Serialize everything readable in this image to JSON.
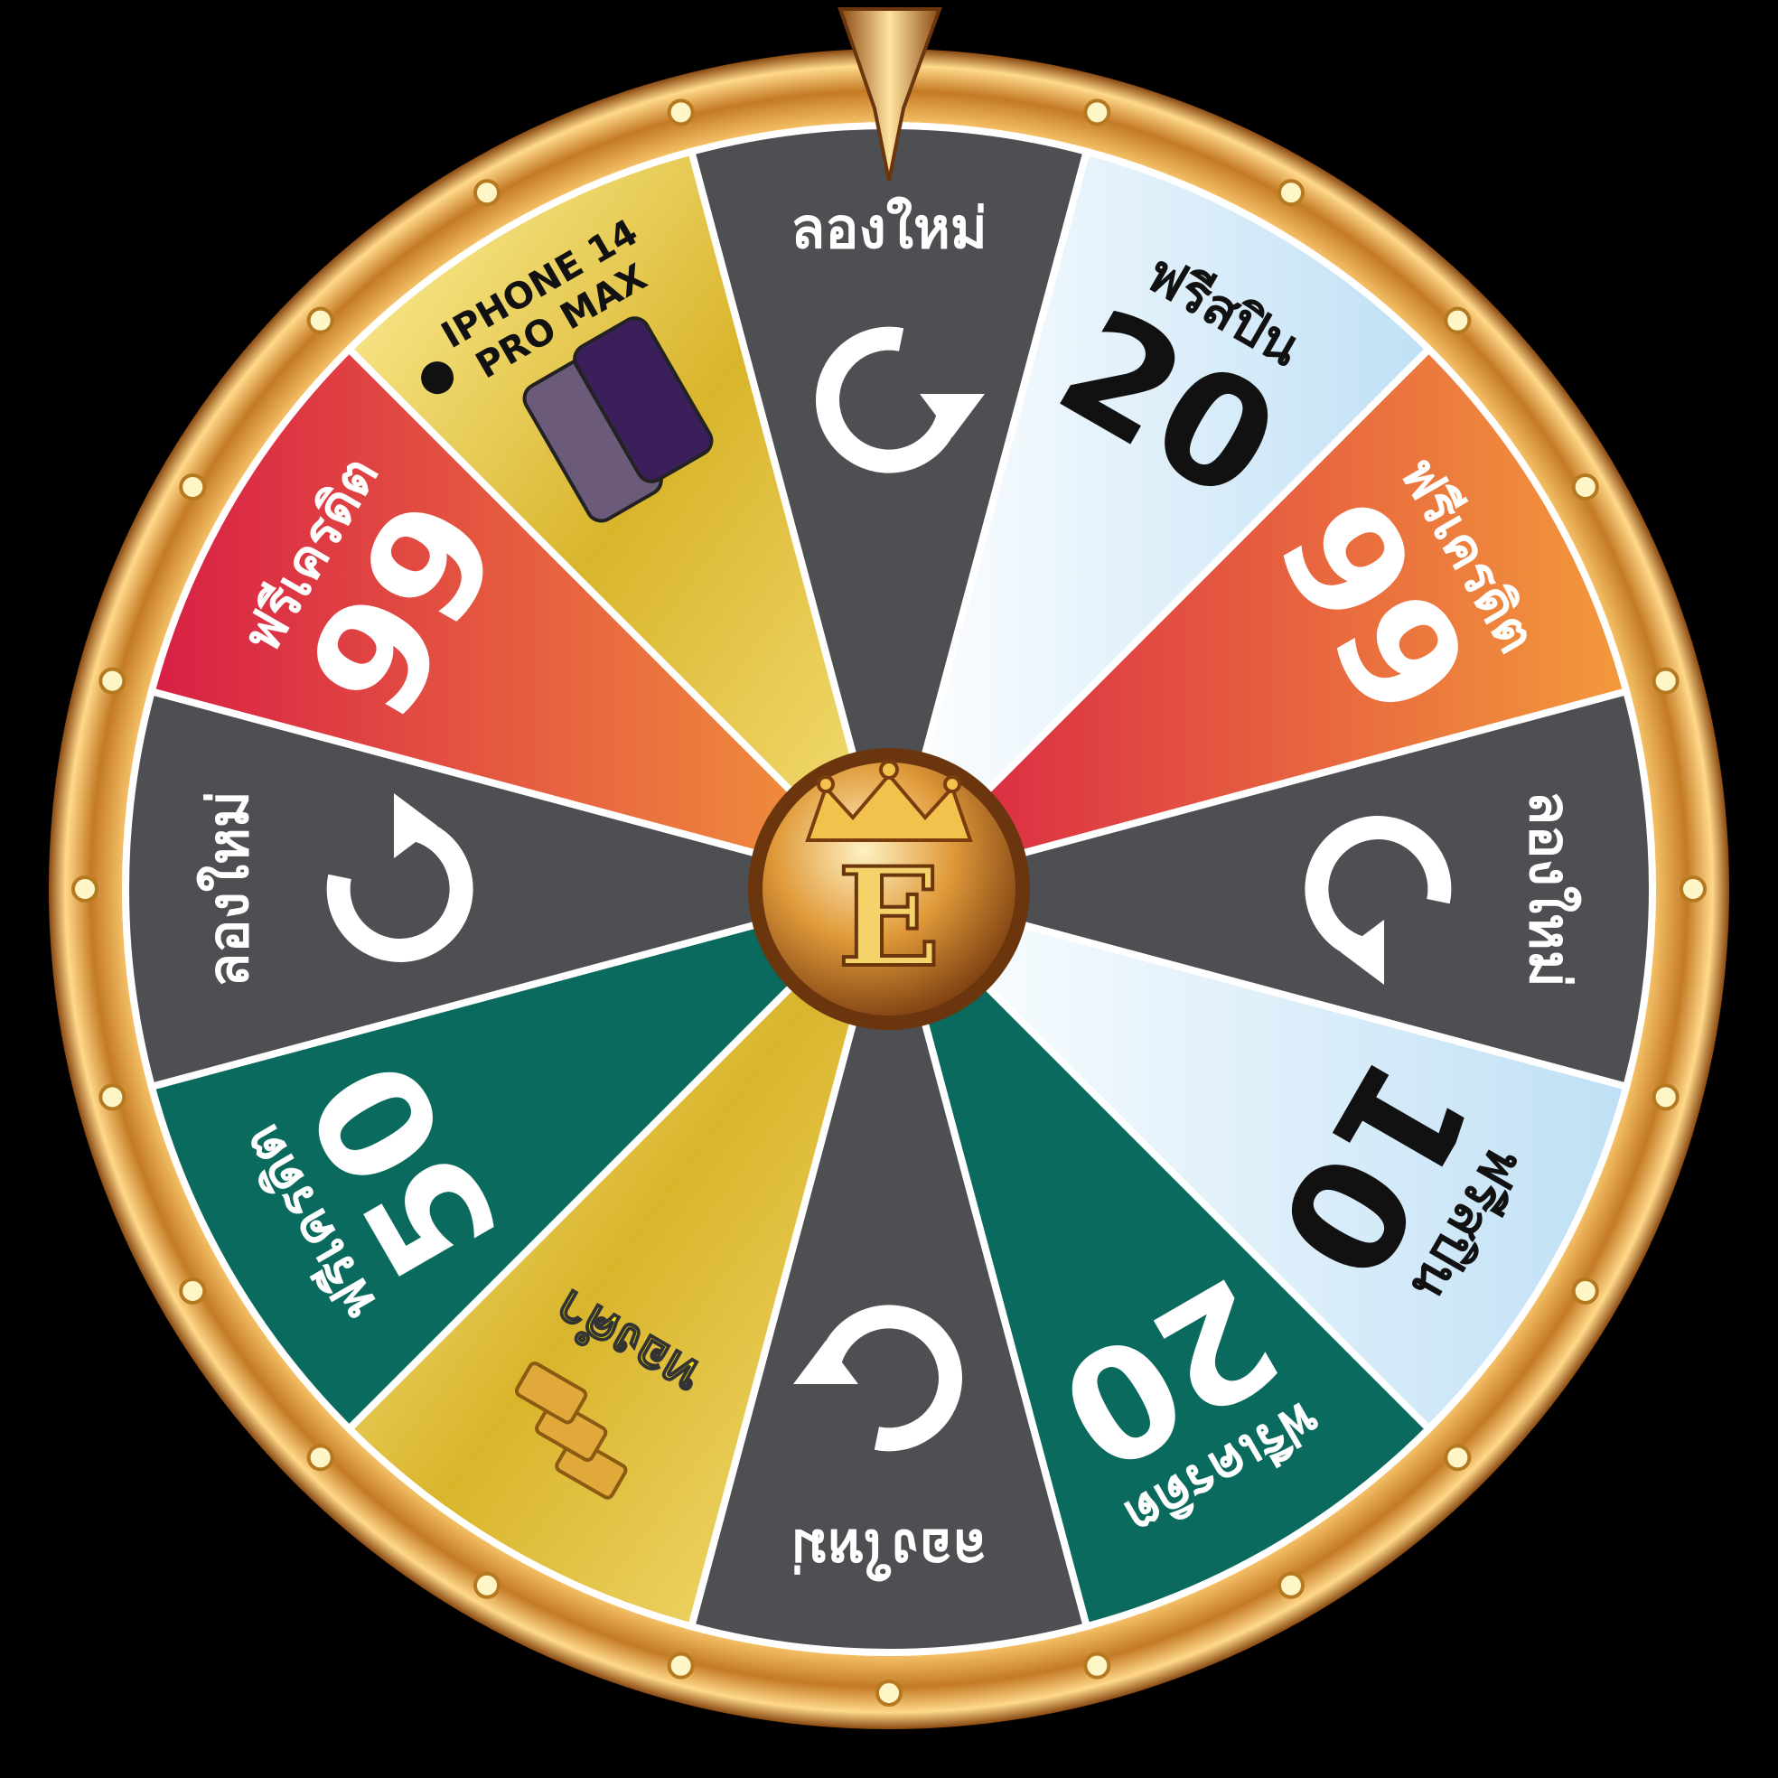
{
  "wheel": {
    "hub_letter": "E",
    "segments": [
      {
        "id": "retry-top",
        "kind": "retry",
        "label": "ลองใหม่",
        "value": "",
        "fill": "#4d4f53",
        "text_color": "#ffffff"
      },
      {
        "id": "freespin-20",
        "kind": "prize",
        "label": "ฟรีสปิน",
        "value": "20",
        "fill": "#d8ecf8",
        "text_color": "#111111"
      },
      {
        "id": "credit-99-right",
        "kind": "prize",
        "label": "ฟรีเครดิต",
        "value": "99",
        "fill": "#e2463f",
        "text_color": "#ffffff"
      },
      {
        "id": "retry-right",
        "kind": "retry",
        "label": "ลองใหม่",
        "value": "",
        "fill": "#4d4f53",
        "text_color": "#ffffff"
      },
      {
        "id": "freespin-10",
        "kind": "prize",
        "label": "ฟรีสปิน",
        "value": "10",
        "fill": "#d8ecf8",
        "text_color": "#111111"
      },
      {
        "id": "credit-20",
        "kind": "prize",
        "label": "ฟรีเครดิต",
        "value": "20",
        "fill": "#0a6a5e",
        "text_color": "#ffffff"
      },
      {
        "id": "retry-bottom",
        "kind": "retry",
        "label": "ลองใหม่",
        "value": "",
        "fill": "#4d4f53",
        "text_color": "#ffffff"
      },
      {
        "id": "gold-bar",
        "kind": "gold",
        "label": "ทองคำ",
        "value": "",
        "fill": "#e2c33a",
        "text_color": "#f5e400"
      },
      {
        "id": "credit-50",
        "kind": "prize",
        "label": "ฟรีเครดิต",
        "value": "50",
        "fill": "#0a6a5e",
        "text_color": "#ffffff"
      },
      {
        "id": "retry-left",
        "kind": "retry",
        "label": "ลองใหม่",
        "value": "",
        "fill": "#4d4f53",
        "text_color": "#ffffff"
      },
      {
        "id": "credit-99-left",
        "kind": "prize",
        "label": "ฟรีเครดิต",
        "value": "99",
        "fill": "#e2463f",
        "text_color": "#ffffff"
      },
      {
        "id": "iphone",
        "kind": "iphone",
        "label": "IPHONE 14",
        "value": "PRO MAX",
        "fill": "#e2c33a",
        "text_color": "#111111"
      }
    ]
  }
}
